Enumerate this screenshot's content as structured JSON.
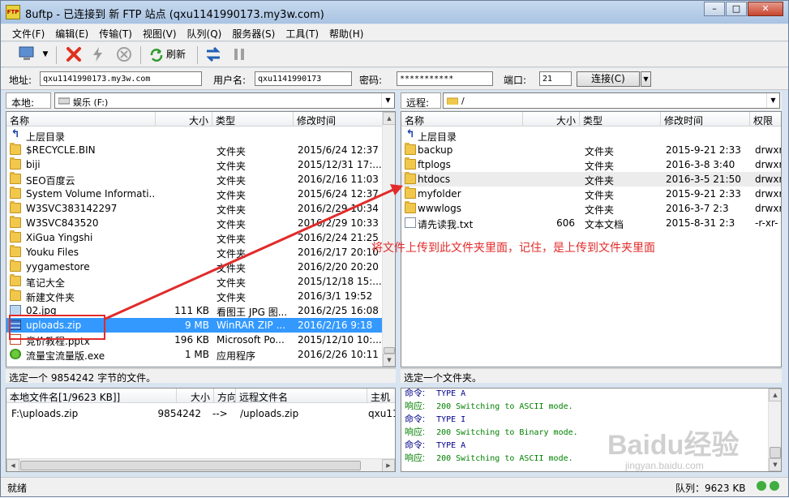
{
  "window": {
    "title": "8uftp - 已连接到 新 FTP 站点 (qxu1141990173.my3w.com)",
    "app_icon_text": "FTP",
    "minimize": "–",
    "maximize": "□",
    "close": "✕"
  },
  "menu": [
    "文件(F)",
    "编辑(E)",
    "传输(T)",
    "视图(V)",
    "队列(Q)",
    "服务器(S)",
    "工具(T)",
    "帮助(H)"
  ],
  "toolbar": {
    "refresh_label": "刷新"
  },
  "address_bar": {
    "address_label": "地址:",
    "address_value": "qxu1141990173.my3w.com",
    "user_label": "用户名:",
    "user_value": "qxu1141990173",
    "password_label": "密码:",
    "password_value": "***********",
    "port_label": "端口:",
    "port_value": "21",
    "connect_label": "连接(C)"
  },
  "local": {
    "path_label": "本地:",
    "path_value": "娱乐 (F:)",
    "columns": [
      "名称",
      "大小",
      "类型",
      "修改时间"
    ],
    "up_label": "上层目录",
    "rows": [
      {
        "name": "$RECYCLE.BIN",
        "size": "",
        "type": "文件夹",
        "modified": "2015/6/24 12:37",
        "icon": "folder"
      },
      {
        "name": "biji",
        "size": "",
        "type": "文件夹",
        "modified": "2015/12/31 17:...",
        "icon": "folder"
      },
      {
        "name": "SEO百度云",
        "size": "",
        "type": "文件夹",
        "modified": "2016/2/16 11:03",
        "icon": "folder"
      },
      {
        "name": "System Volume Informati...",
        "size": "",
        "type": "文件夹",
        "modified": "2015/6/24 12:37",
        "icon": "folder"
      },
      {
        "name": "W3SVC383142297",
        "size": "",
        "type": "文件夹",
        "modified": "2016/2/29 10:34",
        "icon": "folder"
      },
      {
        "name": "W3SVC843520",
        "size": "",
        "type": "文件夹",
        "modified": "2016/2/29 10:33",
        "icon": "folder"
      },
      {
        "name": "XiGua Yingshi",
        "size": "",
        "type": "文件夹",
        "modified": "2016/2/24 21:25",
        "icon": "folder"
      },
      {
        "name": "Youku Files",
        "size": "",
        "type": "文件夹",
        "modified": "2016/2/17 20:10",
        "icon": "folder"
      },
      {
        "name": "yygamestore",
        "size": "",
        "type": "文件夹",
        "modified": "2016/2/20 20:20",
        "icon": "folder"
      },
      {
        "name": "笔记大全",
        "size": "",
        "type": "文件夹",
        "modified": "2015/12/18 15:...",
        "icon": "folder"
      },
      {
        "name": "新建文件夹",
        "size": "",
        "type": "文件夹",
        "modified": "2016/3/1 19:52",
        "icon": "folder"
      },
      {
        "name": "02.jpg",
        "size": "111 KB",
        "type": "看图王 JPG 图...",
        "modified": "2016/2/25 16:08",
        "icon": "jpg"
      },
      {
        "name": "uploads.zip",
        "size": "9 MB",
        "type": "WinRAR ZIP ...",
        "modified": "2016/2/16 9:18",
        "icon": "zip",
        "selected": true
      },
      {
        "name": "竞价教程.pptx",
        "size": "196 KB",
        "type": "Microsoft Po...",
        "modified": "2015/12/10 10:...",
        "icon": "ppt"
      },
      {
        "name": "流量宝流量版.exe",
        "size": "1 MB",
        "type": "应用程序",
        "modified": "2016/2/26 10:11",
        "icon": "exe"
      }
    ],
    "status": "选定一个 9854242 字节的文件。"
  },
  "remote": {
    "path_label": "远程:",
    "path_value": "/",
    "columns": [
      "名称",
      "大小",
      "类型",
      "修改时间",
      "权限"
    ],
    "up_label": "上层目录",
    "rows": [
      {
        "name": "backup",
        "size": "",
        "type": "文件夹",
        "modified": "2015-9-21 2:33",
        "perm": "drwxr",
        "icon": "folder"
      },
      {
        "name": "ftplogs",
        "size": "",
        "type": "文件夹",
        "modified": "2016-3-8 3:40",
        "perm": "drwxr",
        "icon": "folder"
      },
      {
        "name": "htdocs",
        "size": "",
        "type": "文件夹",
        "modified": "2016-3-5 21:50",
        "perm": "drwxr",
        "icon": "folder",
        "hover": true
      },
      {
        "name": "myfolder",
        "size": "",
        "type": "文件夹",
        "modified": "2015-9-21 2:33",
        "perm": "drwxr",
        "icon": "folder"
      },
      {
        "name": "wwwlogs",
        "size": "",
        "type": "文件夹",
        "modified": "2016-3-7 2:3",
        "perm": "drwxr",
        "icon": "folder"
      },
      {
        "name": "请先读我.txt",
        "size": "606",
        "type": "文本文档",
        "modified": "2015-8-31 2:3",
        "perm": "-r-xr-",
        "icon": "file"
      }
    ],
    "status": "选定一个文件夹。"
  },
  "queue": {
    "columns": [
      "本地文件名[1/9623 KB]]",
      "大小",
      "方向",
      "远程文件名",
      "主机"
    ],
    "rows": [
      {
        "local": "F:\\uploads.zip",
        "size": "9854242",
        "direction": "-->",
        "remote": "/uploads.zip",
        "host": "qxu11"
      }
    ]
  },
  "log": [
    {
      "key": "命令:",
      "value": "TYPE A",
      "kind": "cmd"
    },
    {
      "key": "响应:",
      "value": "200 Switching to ASCII mode.",
      "kind": "resp"
    },
    {
      "key": "命令:",
      "value": "TYPE I",
      "kind": "cmd"
    },
    {
      "key": "响应:",
      "value": "200 Switching to Binary mode.",
      "kind": "resp"
    },
    {
      "key": "命令:",
      "value": "TYPE A",
      "kind": "cmd"
    },
    {
      "key": "响应:",
      "value": "200 Switching to ASCII mode.",
      "kind": "resp"
    }
  ],
  "statusbar": {
    "left": "就绪",
    "queue": "队列：9623 KB"
  },
  "annotation": {
    "text": "将文件上传到此文件夹里面，记住，是上传到文件夹里面",
    "color": "#e12b2b"
  },
  "watermark": {
    "main": "Baidu经验",
    "sub": "jingyan.baidu.com"
  }
}
